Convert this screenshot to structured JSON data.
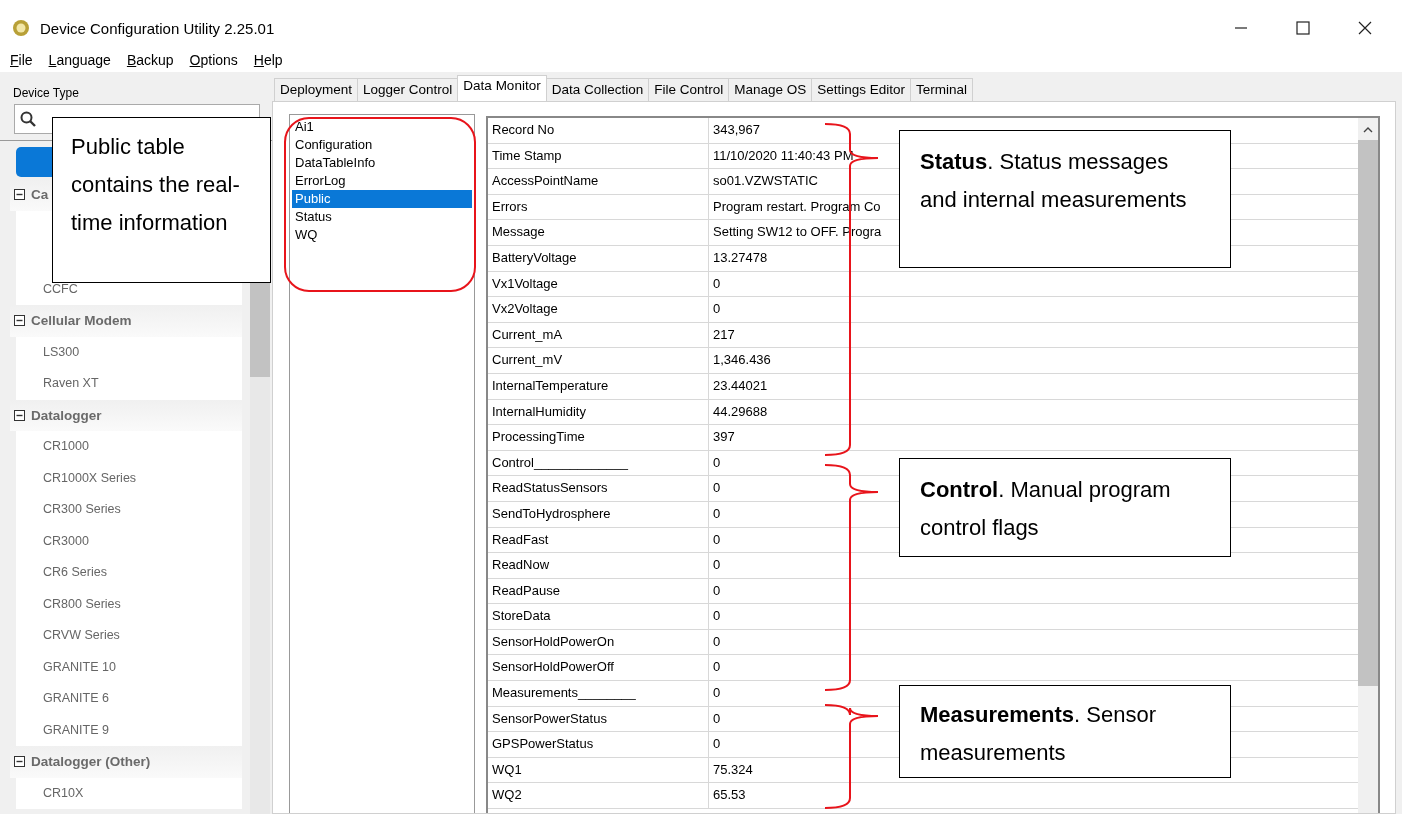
{
  "window": {
    "title": "Device Configuration Utility 2.25.01"
  },
  "menu": [
    "File",
    "Language",
    "Backup",
    "Options",
    "Help"
  ],
  "sidebar": {
    "label": "Device Type",
    "groups": [
      {
        "label": "Ca",
        "expanded": true,
        "items": [
          "CCFC"
        ]
      },
      {
        "label": "Cellular Modem",
        "expanded": true,
        "items": [
          "LS300",
          "Raven XT"
        ]
      },
      {
        "label": "Datalogger",
        "expanded": true,
        "items": [
          "CR1000",
          "CR1000X Series",
          "CR300 Series",
          "CR3000",
          "CR6 Series",
          "CR800 Series",
          "CRVW Series",
          "GRANITE 10",
          "GRANITE 6",
          "GRANITE 9"
        ]
      },
      {
        "label": "Datalogger (Other)",
        "expanded": true,
        "items": [
          "CR10X"
        ]
      }
    ]
  },
  "tabs": [
    {
      "label": "Deployment",
      "selected": false
    },
    {
      "label": "Logger Control",
      "selected": false
    },
    {
      "label": "Data Monitor",
      "selected": true
    },
    {
      "label": "Data Collection",
      "selected": false
    },
    {
      "label": "File Control",
      "selected": false
    },
    {
      "label": "Manage OS",
      "selected": false
    },
    {
      "label": "Settings Editor",
      "selected": false
    },
    {
      "label": "Terminal",
      "selected": false
    }
  ],
  "tables": [
    {
      "label": "Ai1",
      "selected": false
    },
    {
      "label": "Configuration",
      "selected": false
    },
    {
      "label": "DataTableInfo",
      "selected": false
    },
    {
      "label": "ErrorLog",
      "selected": false
    },
    {
      "label": "Public",
      "selected": true
    },
    {
      "label": "Status",
      "selected": false
    },
    {
      "label": "WQ",
      "selected": false
    }
  ],
  "grid": [
    {
      "name": "Record No",
      "value": "343,967"
    },
    {
      "name": "Time Stamp",
      "value": "11/10/2020 11:40:43 PM"
    },
    {
      "name": "AccessPointName",
      "value": "so01.VZWSTATIC"
    },
    {
      "name": "Errors",
      "value": "Program restart. Program Co"
    },
    {
      "name": "Message",
      "value": "Setting SW12 to OFF. Progra"
    },
    {
      "name": "BatteryVoltage",
      "value": "13.27478"
    },
    {
      "name": "Vx1Voltage",
      "value": "0"
    },
    {
      "name": "Vx2Voltage",
      "value": "0"
    },
    {
      "name": "Current_mA",
      "value": "217"
    },
    {
      "name": "Current_mV",
      "value": "1,346.436"
    },
    {
      "name": "InternalTemperature",
      "value": "23.44021"
    },
    {
      "name": "InternalHumidity",
      "value": "44.29688"
    },
    {
      "name": "ProcessingTime",
      "value": "397"
    },
    {
      "name": "Control_____________",
      "value": "0"
    },
    {
      "name": "ReadStatusSensors",
      "value": "0"
    },
    {
      "name": "SendToHydrosphere",
      "value": "0"
    },
    {
      "name": "ReadFast",
      "value": "0"
    },
    {
      "name": "ReadNow",
      "value": "0"
    },
    {
      "name": "ReadPause",
      "value": "0"
    },
    {
      "name": "StoreData",
      "value": "0"
    },
    {
      "name": "SensorHoldPowerOn",
      "value": "0"
    },
    {
      "name": "SensorHoldPowerOff",
      "value": "0"
    },
    {
      "name": "Measurements________",
      "value": "0"
    },
    {
      "name": "SensorPowerStatus",
      "value": "0"
    },
    {
      "name": "GPSPowerStatus",
      "value": "0"
    },
    {
      "name": "WQ1",
      "value": "75.324"
    },
    {
      "name": "WQ2",
      "value": "65.53"
    }
  ],
  "callouts": [
    {
      "kind": "table",
      "text": "Public table contains the real-time information"
    },
    {
      "kind": "status",
      "text": "**Status**. Status messages and internal measurements"
    },
    {
      "kind": "control",
      "text": "**Control**. Manual program control flags"
    },
    {
      "kind": "measurements",
      "text": "**Measurements**. Sensor measurements"
    }
  ]
}
